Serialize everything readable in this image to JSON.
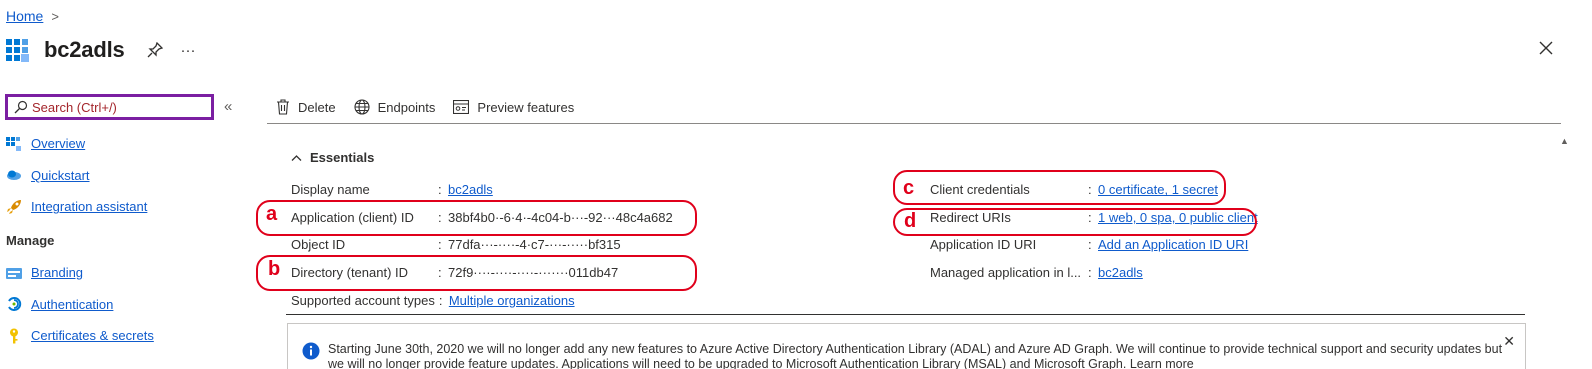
{
  "breadcrumb": {
    "home": "Home",
    "separator": ">"
  },
  "header": {
    "title": "bc2adls",
    "pin_icon": "pin-icon",
    "more_icon": "more-icon",
    "close_icon": "close-icon"
  },
  "search": {
    "placeholder": "Search (Ctrl+/)",
    "collapse": "«"
  },
  "nav": {
    "items": [
      {
        "label": "Overview",
        "icon": "overview-icon"
      },
      {
        "label": "Quickstart",
        "icon": "quickstart-icon"
      },
      {
        "label": "Integration assistant",
        "icon": "rocket-icon"
      }
    ],
    "section": "Manage",
    "manage_items": [
      {
        "label": "Branding",
        "icon": "branding-icon"
      },
      {
        "label": "Authentication",
        "icon": "authentication-icon"
      },
      {
        "label": "Certificates & secrets",
        "icon": "key-icon"
      }
    ]
  },
  "toolbar": {
    "delete": "Delete",
    "endpoints": "Endpoints",
    "preview": "Preview features"
  },
  "essentials": {
    "heading": "Essentials",
    "left": [
      {
        "key": "Display name",
        "value": "bc2adls",
        "link": true
      },
      {
        "key": "Application (client) ID",
        "value": "38bf4b0·-6·4·-4c04-b···-92···48c4a682",
        "link": false
      },
      {
        "key": "Object ID",
        "value": "77dfa···-····-4·c7-···-·····bf315",
        "link": false
      },
      {
        "key": "Directory (tenant) ID",
        "value": "72f9····-····-····-·······011db47",
        "link": false
      },
      {
        "key": "Supported account types",
        "value": "Multiple organizations",
        "link": true
      }
    ],
    "right": [
      {
        "key": "Client credentials",
        "value": "0 certificate, 1 secret",
        "link": true
      },
      {
        "key": "Redirect URIs",
        "value": "1 web, 0 spa, 0 public client",
        "link": true
      },
      {
        "key": "Application ID URI",
        "value": "Add an Application ID URI",
        "link": true
      },
      {
        "key": "Managed application in l...",
        "value": "bc2adls",
        "link": true
      }
    ]
  },
  "annotations": {
    "a": "a",
    "b": "b",
    "c": "c",
    "d": "d",
    "color": "#e0001b"
  },
  "banner": {
    "text": "Starting June 30th, 2020 we will no longer add any new features to Azure Active Directory Authentication Library (ADAL) and Azure AD Graph. We will continue to provide technical support and security updates but we will no longer provide feature updates. Applications will need to be upgraded to Microsoft Authentication Library (MSAL) and Microsoft Graph. Learn more",
    "close": "✕"
  },
  "colors": {
    "link": "#0f5bcc",
    "search_border": "#7b1fa2",
    "annotation": "#e0001b"
  }
}
